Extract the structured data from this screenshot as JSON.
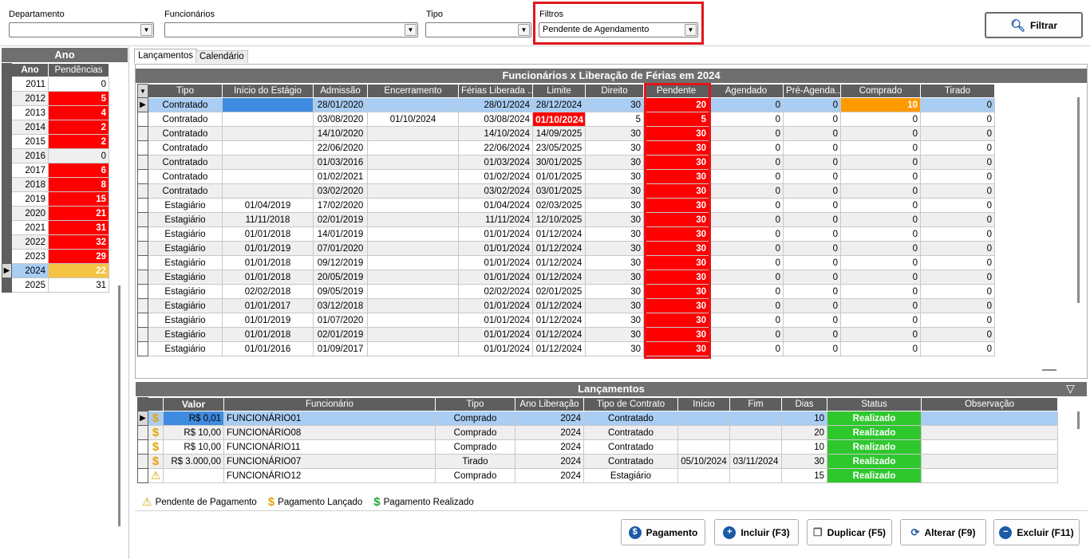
{
  "filters": {
    "departamento_label": "Departamento",
    "departamento_value": "",
    "funcionarios_label": "Funcionários",
    "funcionarios_value": "",
    "tipo_label": "Tipo",
    "tipo_value": "",
    "filtros_label": "Filtros",
    "filtros_value": "Pendente de Agendamento",
    "filtrar_button": "Filtrar"
  },
  "year_panel": {
    "title": "Ano",
    "col_ano": "Ano",
    "col_pendencias": "Pendências",
    "rows": [
      {
        "ano": "2011",
        "pend": "0",
        "style": "wht"
      },
      {
        "ano": "2012",
        "pend": "5",
        "style": "red"
      },
      {
        "ano": "2013",
        "pend": "4",
        "style": "red"
      },
      {
        "ano": "2014",
        "pend": "2",
        "style": "red"
      },
      {
        "ano": "2015",
        "pend": "2",
        "style": "red"
      },
      {
        "ano": "2016",
        "pend": "0",
        "style": "wht"
      },
      {
        "ano": "2017",
        "pend": "6",
        "style": "red"
      },
      {
        "ano": "2018",
        "pend": "8",
        "style": "red"
      },
      {
        "ano": "2019",
        "pend": "15",
        "style": "red"
      },
      {
        "ano": "2020",
        "pend": "21",
        "style": "red"
      },
      {
        "ano": "2021",
        "pend": "31",
        "style": "red"
      },
      {
        "ano": "2022",
        "pend": "32",
        "style": "red"
      },
      {
        "ano": "2023",
        "pend": "29",
        "style": "red"
      },
      {
        "ano": "2024",
        "pend": "22",
        "style": "sel"
      },
      {
        "ano": "2025",
        "pend": "31",
        "style": "wht"
      }
    ]
  },
  "tabs": {
    "lancamentos": "Lançamentos",
    "calendario": "Calendário"
  },
  "main_grid": {
    "title": "Funcionários x Liberação de Férias em 2024",
    "headers": [
      "Tipo",
      "Início do Estágio",
      "Admissão",
      "Encerramento",
      "Férias Liberada ...",
      "Limite",
      "Direito",
      "Pendente",
      "Agendado",
      "Pré-Agenda...",
      "Comprado",
      "Tirado"
    ],
    "rows": [
      [
        "Contratado",
        "",
        "28/01/2020",
        "",
        "28/01/2024",
        "28/12/2024",
        "30",
        "20",
        "0",
        "0",
        "10",
        "0"
      ],
      [
        "Contratado",
        "",
        "03/08/2020",
        "01/10/2024",
        "03/08/2024",
        "01/10/2024",
        "5",
        "5",
        "0",
        "0",
        "0",
        "0"
      ],
      [
        "Contratado",
        "",
        "14/10/2020",
        "",
        "14/10/2024",
        "14/09/2025",
        "30",
        "30",
        "0",
        "0",
        "0",
        "0"
      ],
      [
        "Contratado",
        "",
        "22/06/2020",
        "",
        "22/06/2024",
        "23/05/2025",
        "30",
        "30",
        "0",
        "0",
        "0",
        "0"
      ],
      [
        "Contratado",
        "",
        "01/03/2016",
        "",
        "01/03/2024",
        "30/01/2025",
        "30",
        "30",
        "0",
        "0",
        "0",
        "0"
      ],
      [
        "Contratado",
        "",
        "01/02/2021",
        "",
        "01/02/2024",
        "01/01/2025",
        "30",
        "30",
        "0",
        "0",
        "0",
        "0"
      ],
      [
        "Contratado",
        "",
        "03/02/2020",
        "",
        "03/02/2024",
        "03/01/2025",
        "30",
        "30",
        "0",
        "0",
        "0",
        "0"
      ],
      [
        "Estagiário",
        "01/04/2019",
        "17/02/2020",
        "",
        "01/04/2024",
        "02/03/2025",
        "30",
        "30",
        "0",
        "0",
        "0",
        "0"
      ],
      [
        "Estagiário",
        "11/11/2018",
        "02/01/2019",
        "",
        "11/11/2024",
        "12/10/2025",
        "30",
        "30",
        "0",
        "0",
        "0",
        "0"
      ],
      [
        "Estagiário",
        "01/01/2018",
        "14/01/2019",
        "",
        "01/01/2024",
        "01/12/2024",
        "30",
        "30",
        "0",
        "0",
        "0",
        "0"
      ],
      [
        "Estagiário",
        "01/01/2019",
        "07/01/2020",
        "",
        "01/01/2024",
        "01/12/2024",
        "30",
        "30",
        "0",
        "0",
        "0",
        "0"
      ],
      [
        "Estagiário",
        "01/01/2018",
        "09/12/2019",
        "",
        "01/01/2024",
        "01/12/2024",
        "30",
        "30",
        "0",
        "0",
        "0",
        "0"
      ],
      [
        "Estagiário",
        "01/01/2018",
        "20/05/2019",
        "",
        "01/01/2024",
        "01/12/2024",
        "30",
        "30",
        "0",
        "0",
        "0",
        "0"
      ],
      [
        "Estagiário",
        "02/02/2018",
        "09/05/2019",
        "",
        "02/02/2024",
        "02/01/2025",
        "30",
        "30",
        "0",
        "0",
        "0",
        "0"
      ],
      [
        "Estagiário",
        "01/01/2017",
        "03/12/2018",
        "",
        "01/01/2024",
        "01/12/2024",
        "30",
        "30",
        "0",
        "0",
        "0",
        "0"
      ],
      [
        "Estagiário",
        "01/01/2019",
        "01/07/2020",
        "",
        "01/01/2024",
        "01/12/2024",
        "30",
        "30",
        "0",
        "0",
        "0",
        "0"
      ],
      [
        "Estagiário",
        "01/01/2018",
        "02/01/2019",
        "",
        "01/01/2024",
        "01/12/2024",
        "30",
        "30",
        "0",
        "0",
        "0",
        "0"
      ],
      [
        "Estagiário",
        "01/01/2016",
        "01/09/2017",
        "",
        "01/01/2024",
        "01/12/2024",
        "30",
        "30",
        "0",
        "0",
        "0",
        "0"
      ]
    ]
  },
  "lanc_grid": {
    "title": "Lançamentos",
    "headers": [
      "Valor",
      "Funcionário",
      "Tipo",
      "Ano Liberação",
      "Tipo de Contrato",
      "Início",
      "Fim",
      "Dias",
      "Status",
      "Observação"
    ],
    "rows": [
      {
        "icon": "dollar",
        "cells": [
          "R$ 0,01",
          "FUNCIONÁRIO01",
          "Comprado",
          "2024",
          "Contratado",
          "",
          "",
          "10",
          "Realizado",
          ""
        ]
      },
      {
        "icon": "dollar",
        "cells": [
          "R$ 10,00",
          "FUNCIONÁRIO08",
          "Comprado",
          "2024",
          "Contratado",
          "",
          "",
          "20",
          "Realizado",
          ""
        ]
      },
      {
        "icon": "dollar",
        "cells": [
          "R$ 10,00",
          "FUNCIONÁRIO11",
          "Comprado",
          "2024",
          "Contratado",
          "",
          "",
          "10",
          "Realizado",
          ""
        ]
      },
      {
        "icon": "dollar",
        "cells": [
          "R$ 3.000,00",
          "FUNCIONÁRIO07",
          "Tirado",
          "2024",
          "Contratado",
          "05/10/2024",
          "03/11/2024",
          "30",
          "Realizado",
          ""
        ]
      },
      {
        "icon": "warning",
        "cells": [
          "",
          "FUNCIONÁRIO12",
          "Comprado",
          "2024",
          "Estagiário",
          "",
          "",
          "15",
          "Realizado",
          ""
        ]
      }
    ]
  },
  "legend": {
    "pendente": "Pendente de Pagamento",
    "lancado": "Pagamento Lançado",
    "realizado": "Pagamento Realizado"
  },
  "actions": {
    "pagamento": "Pagamento",
    "incluir": "Incluir (F3)",
    "duplicar": "Duplicar (F5)",
    "alterar": "Alterar (F9)",
    "excluir": "Excluir (F11)"
  },
  "colors": {
    "highlight_border": "#e0161b",
    "pending_red": "#ff0000",
    "bought_orange": "#ff9900",
    "done_green": "#2ec82e",
    "selected_blue": "#a9cdf3"
  }
}
